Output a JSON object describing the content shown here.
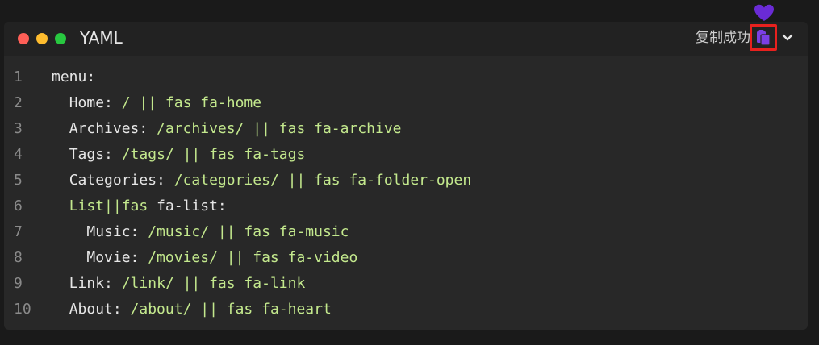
{
  "header": {
    "language": "YAML",
    "copy_status": "复制成功",
    "dot_colors": [
      "#ff5f57",
      "#febc2e",
      "#28c840"
    ],
    "copy_icon": "clipboard-icon",
    "copy_icon_color": "#7b3fe4",
    "heart_icon": "heart-icon",
    "heart_color": "#6a2bd6",
    "highlight_color": "#e8211e",
    "expand_icon": "chevron-down-icon"
  },
  "colors": {
    "background": "#1a1a1a",
    "panel": "#282828",
    "header": "#222222",
    "key_text": "#e6e6e6",
    "string_text": "#c3e88d",
    "line_number": "#8a8a8a"
  },
  "code": {
    "lines": [
      {
        "n": "1",
        "indent": "",
        "key": "menu:",
        "value": ""
      },
      {
        "n": "2",
        "indent": "  ",
        "key": "Home: ",
        "value": "/ || fas fa-home"
      },
      {
        "n": "3",
        "indent": "  ",
        "key": "Archives: ",
        "value": "/archives/ || fas fa-archive"
      },
      {
        "n": "4",
        "indent": "  ",
        "key": "Tags: ",
        "value": "/tags/ || fas fa-tags"
      },
      {
        "n": "5",
        "indent": "  ",
        "key": "Categories: ",
        "value": "/categories/ || fas fa-folder-open"
      },
      {
        "n": "6",
        "indent": "  ",
        "str_prefix": "List||fas",
        "key": " fa-list:",
        "value": ""
      },
      {
        "n": "7",
        "indent": "    ",
        "key": "Music: ",
        "value": "/music/ || fas fa-music"
      },
      {
        "n": "8",
        "indent": "    ",
        "key": "Movie: ",
        "value": "/movies/ || fas fa-video"
      },
      {
        "n": "9",
        "indent": "  ",
        "key": "Link: ",
        "value": "/link/ || fas fa-link"
      },
      {
        "n": "10",
        "indent": "  ",
        "key": "About: ",
        "value": "/about/ || fas fa-heart"
      }
    ]
  }
}
